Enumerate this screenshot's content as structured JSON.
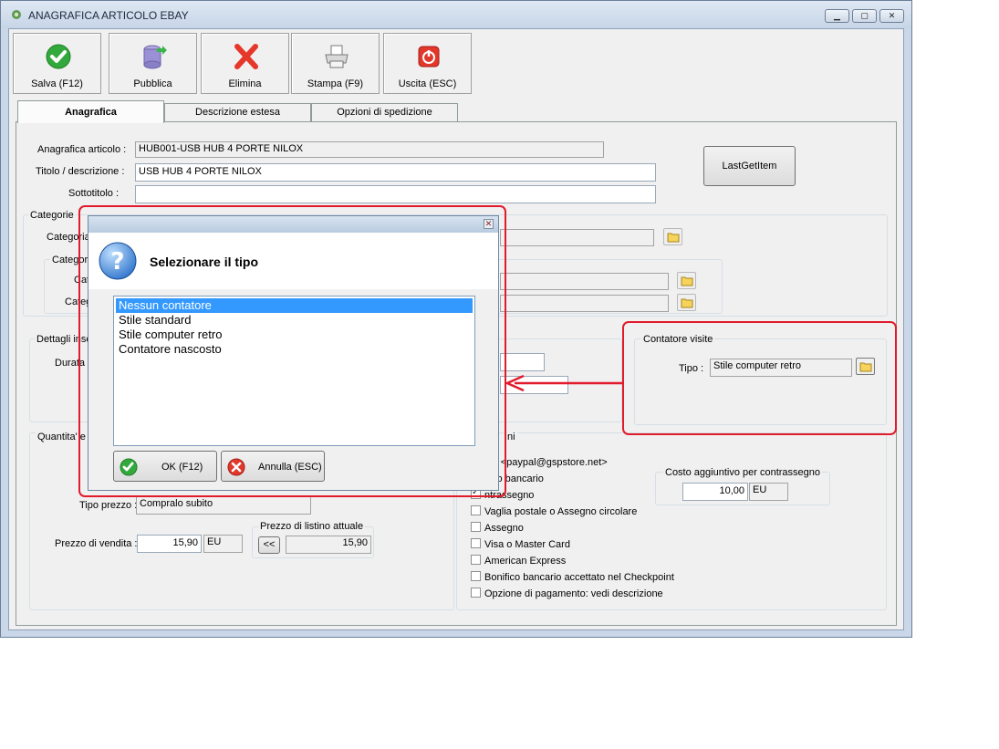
{
  "window": {
    "title": "ANAGRAFICA ARTICOLO EBAY",
    "minimize": "▁",
    "maximize": "▢",
    "close": "✕"
  },
  "toolbar": {
    "save": "Salva (F12)",
    "publish": "Pubblica",
    "delete": "Elimina",
    "print": "Stampa (F9)",
    "exit": "Uscita (ESC)"
  },
  "tabs": [
    "Anagrafica",
    "Descrizione estesa",
    "Opzioni di spedizione"
  ],
  "form": {
    "articolo_label": "Anagrafica articolo :",
    "articolo_value": "HUB001-USB HUB 4 PORTE NILOX",
    "titolo_label": "Titolo / descrizione :",
    "titolo_value": "USB HUB 4 PORTE NILOX",
    "sottotitolo_label": "Sottotitolo :",
    "sottotitolo_value": "",
    "lastget_button": "LastGetItem"
  },
  "categorie": {
    "group_label": "Categorie",
    "categoria_label": "Categoria",
    "subgroup_label": "Categorie",
    "cat1_label": "Cat",
    "cat2_label": "Categ"
  },
  "dettagli": {
    "group_label": "Dettagli inse",
    "durata_label": "Durata i"
  },
  "quantita": {
    "group_label": "Quantita' e p",
    "tipo_prezzo_label": "Tipo prezzo :",
    "tipo_prezzo_value": "Compralo subito",
    "prezzo_vendita_label": "Prezzo di vendita :",
    "prezzo_vendita_value": "15,90",
    "currency": "EU",
    "listino_label": "Prezzo di listino attuale",
    "listino_button": "<<",
    "listino_value": "15,90"
  },
  "contatore": {
    "group_label": "Contatore visite",
    "tipo_label": "Tipo :",
    "tipo_value": "Stile computer retro"
  },
  "pagamento": {
    "group_label": "ni",
    "paypal": "pal <paypal@gspstore.net>",
    "bonifico": "ifico bancario",
    "contrassegno": "ntrassegno",
    "vaglia": "Vaglia postale o Assegno circolare",
    "assegno": "Assegno",
    "visa": "Visa o Master Card",
    "amex": "American Express",
    "bonifico_checkpoint": "Bonifico bancario accettato nel Checkpoint",
    "opzione": "Opzione di pagamento: vedi descrizione",
    "costo_label": "Costo aggiuntivo per contrassegno",
    "costo_value": "10,00",
    "costo_currency": "EU"
  },
  "dialog": {
    "message": "Selezionare il tipo",
    "close": "✕",
    "options": [
      "Nessun contatore",
      "Stile standard",
      "Stile computer retro",
      "Contatore nascosto"
    ],
    "ok": "OK (F12)",
    "cancel": "Annulla (ESC)"
  },
  "colors": {
    "selection": "#3399ff",
    "annotation": "#e21b2c"
  }
}
